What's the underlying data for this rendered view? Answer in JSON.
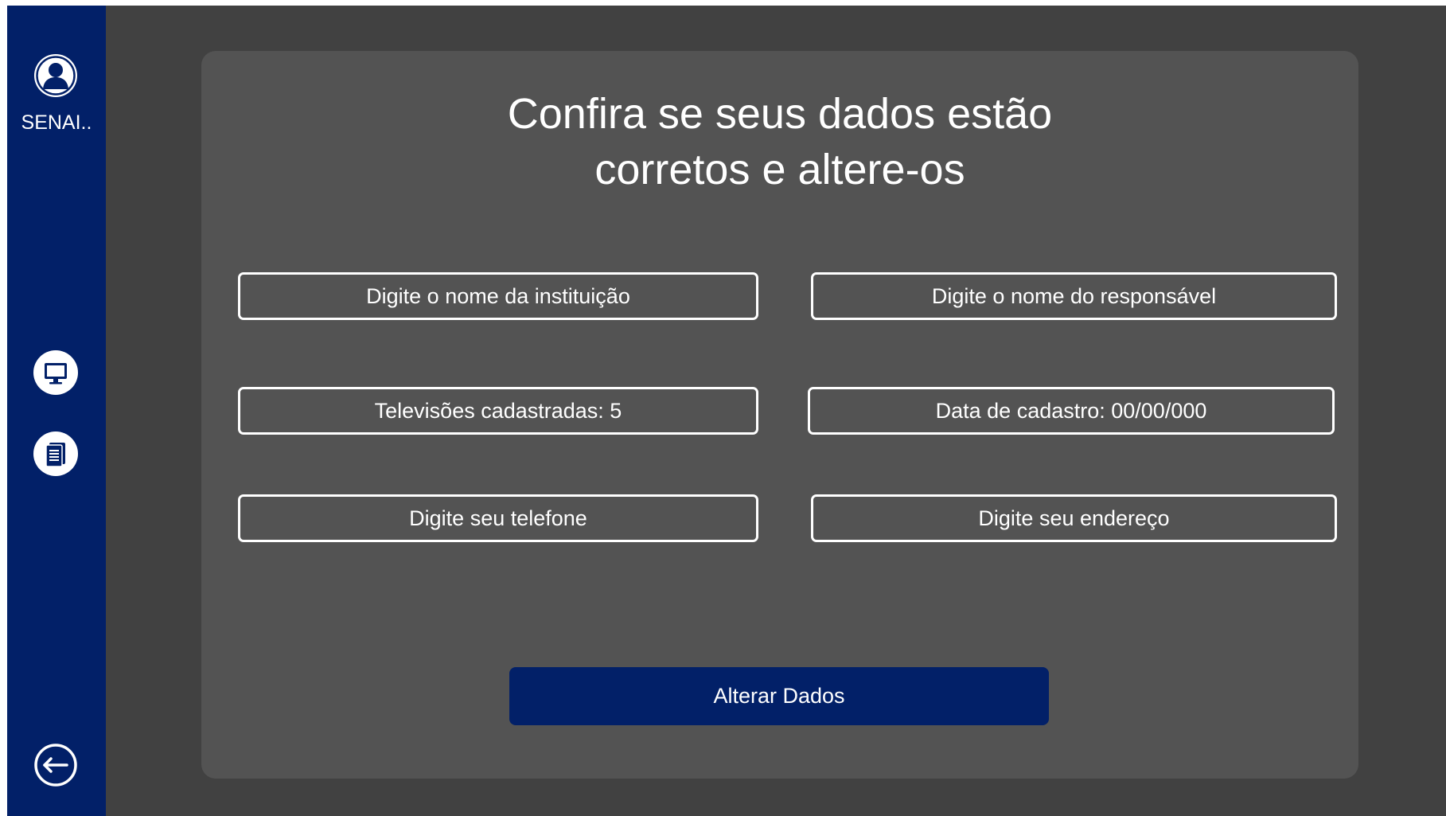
{
  "sidebar": {
    "user_name": "SENAI..",
    "icons": [
      "user-avatar-icon",
      "monitor-icon",
      "document-icon",
      "logout-icon"
    ],
    "accent_color": "#022068"
  },
  "main": {
    "title_line1": "Confira se seus dados estão",
    "title_line2": "corretos e altere-os",
    "fields": {
      "institution_placeholder": "Digite o nome da instituição",
      "responsible_placeholder": "Digite o nome do responsável",
      "tv_count_placeholder": "Televisões cadastradas: 5",
      "register_date_placeholder": "Data de cadastro: 00/00/000",
      "phone_placeholder": "Digite seu telefone",
      "address_placeholder": "Digite seu endereço"
    },
    "submit_label": "Alterar Dados"
  }
}
